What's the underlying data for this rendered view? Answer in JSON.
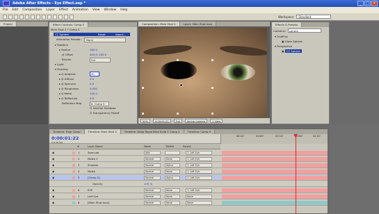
{
  "window": {
    "title": "Adobe After Effects - Eye Effect.aep *"
  },
  "menu": [
    "File",
    "Edit",
    "Composition",
    "Layer",
    "Effect",
    "Animation",
    "View",
    "Window",
    "Help"
  ],
  "workspace": {
    "label": "Workspace:",
    "value": "Standard"
  },
  "project_panel": {
    "tab": "Project"
  },
  "effect_controls": {
    "tab": "Effect Controls: Comp 5",
    "header": "Main Shot 2 * Comp 5",
    "effect_name": "CC Sphere",
    "reset": "Reset",
    "about": "About...",
    "presets_label": "Animation Presets:",
    "presets_value": "None",
    "rows": [
      {
        "label": "Rotation",
        "value": ""
      },
      {
        "label": "Radius",
        "value": "180.0"
      },
      {
        "label": "Offset",
        "value": "400.0, 200.0"
      },
      {
        "label": "Render",
        "value": "Full"
      },
      {
        "label": "Light",
        "value": ""
      },
      {
        "label": "Shading",
        "value": ""
      },
      {
        "label": "Ambient",
        "value": "90"
      },
      {
        "label": "Diffuse",
        "value": "0.0"
      },
      {
        "label": "Specular",
        "value": "0.0"
      },
      {
        "label": "Roughness",
        "value": "0.000"
      },
      {
        "label": "Metal",
        "value": "100.0"
      },
      {
        "label": "Reflective",
        "value": "0.0"
      },
      {
        "label": "Reflection Map",
        "value": "6. Comp 5"
      }
    ],
    "internal_shadows": "Internal Shadows",
    "transparency_falloff": "Transparency Falloff"
  },
  "composition": {
    "tab": "Composition: Main Shot 2",
    "layer_tab": "Layer: Main Shot.mov",
    "footer": {
      "zoom": "50%",
      "time": "0:00:01:22",
      "res": "Full",
      "camera": "Active Camera",
      "views": "1 View"
    }
  },
  "effects_presets": {
    "tab": "Effects & Presets",
    "contains_label": "Contains:",
    "contains_value": "sphere",
    "items": [
      "FreePlus",
      "Glass Sphere",
      "Perspective",
      "CC Sphere"
    ]
  },
  "timeline": {
    "tabs": [
      "Timeline: Final Comp",
      "Timeline: Main Shot 2",
      "Timeline: Deep Royal Blue Solid 1 Comp 1",
      "Timeline: Comp 5"
    ],
    "timecode": "0:00:01:22",
    "fps": "(23.98 fps)",
    "headers": {
      "num": "#",
      "layer_name": "Layer Name",
      "mode": "Mode",
      "trkmat": "TrkMat",
      "parent": "Parent"
    },
    "ruler": [
      "00:12f",
      "01:00f",
      "01:12f",
      "02:00f",
      "02:12f"
    ],
    "layers": [
      {
        "num": "1",
        "name": "Specular",
        "mode": "Add",
        "trkmat": "",
        "parent": "1. Left Eye",
        "color": "#f0a0a0"
      },
      {
        "num": "2",
        "name": "Matte 2",
        "mode": "Normal",
        "trkmat": "None",
        "parent": "1. Left Eye",
        "color": "#f0a0a0"
      },
      {
        "num": "3",
        "name": "Shadow",
        "mode": "Normal",
        "trkmat": "Alpha",
        "parent": "1. Left Eye",
        "color": "#f0a0a0"
      },
      {
        "num": "4",
        "name": "Matte",
        "mode": "Normal",
        "trkmat": "None",
        "parent": "1. Left Eye",
        "color": "#f0a0a0"
      },
      {
        "num": "5",
        "name": "[Comp 5]",
        "mode": "Normal",
        "trkmat": "Alpha",
        "parent": "1. Left Eye",
        "color": "#f0a0a0"
      },
      {
        "num": "",
        "name": "Opacity",
        "mode": "100 %",
        "trkmat": "",
        "parent": "",
        "color": ""
      },
      {
        "num": "6",
        "name": "EYE",
        "mode": "Normal",
        "trkmat": "None",
        "parent": "1. Left Eye",
        "color": "#f0a0a0"
      },
      {
        "num": "7",
        "name": "Left Eye",
        "mode": "Normal",
        "trkmat": "None",
        "parent": "None",
        "color": "#f0a0a0"
      },
      {
        "num": "8",
        "name": "[Main Shot.mov]",
        "mode": "Normal",
        "trkmat": "None",
        "parent": "None",
        "color": "#8fc9c9"
      }
    ]
  }
}
